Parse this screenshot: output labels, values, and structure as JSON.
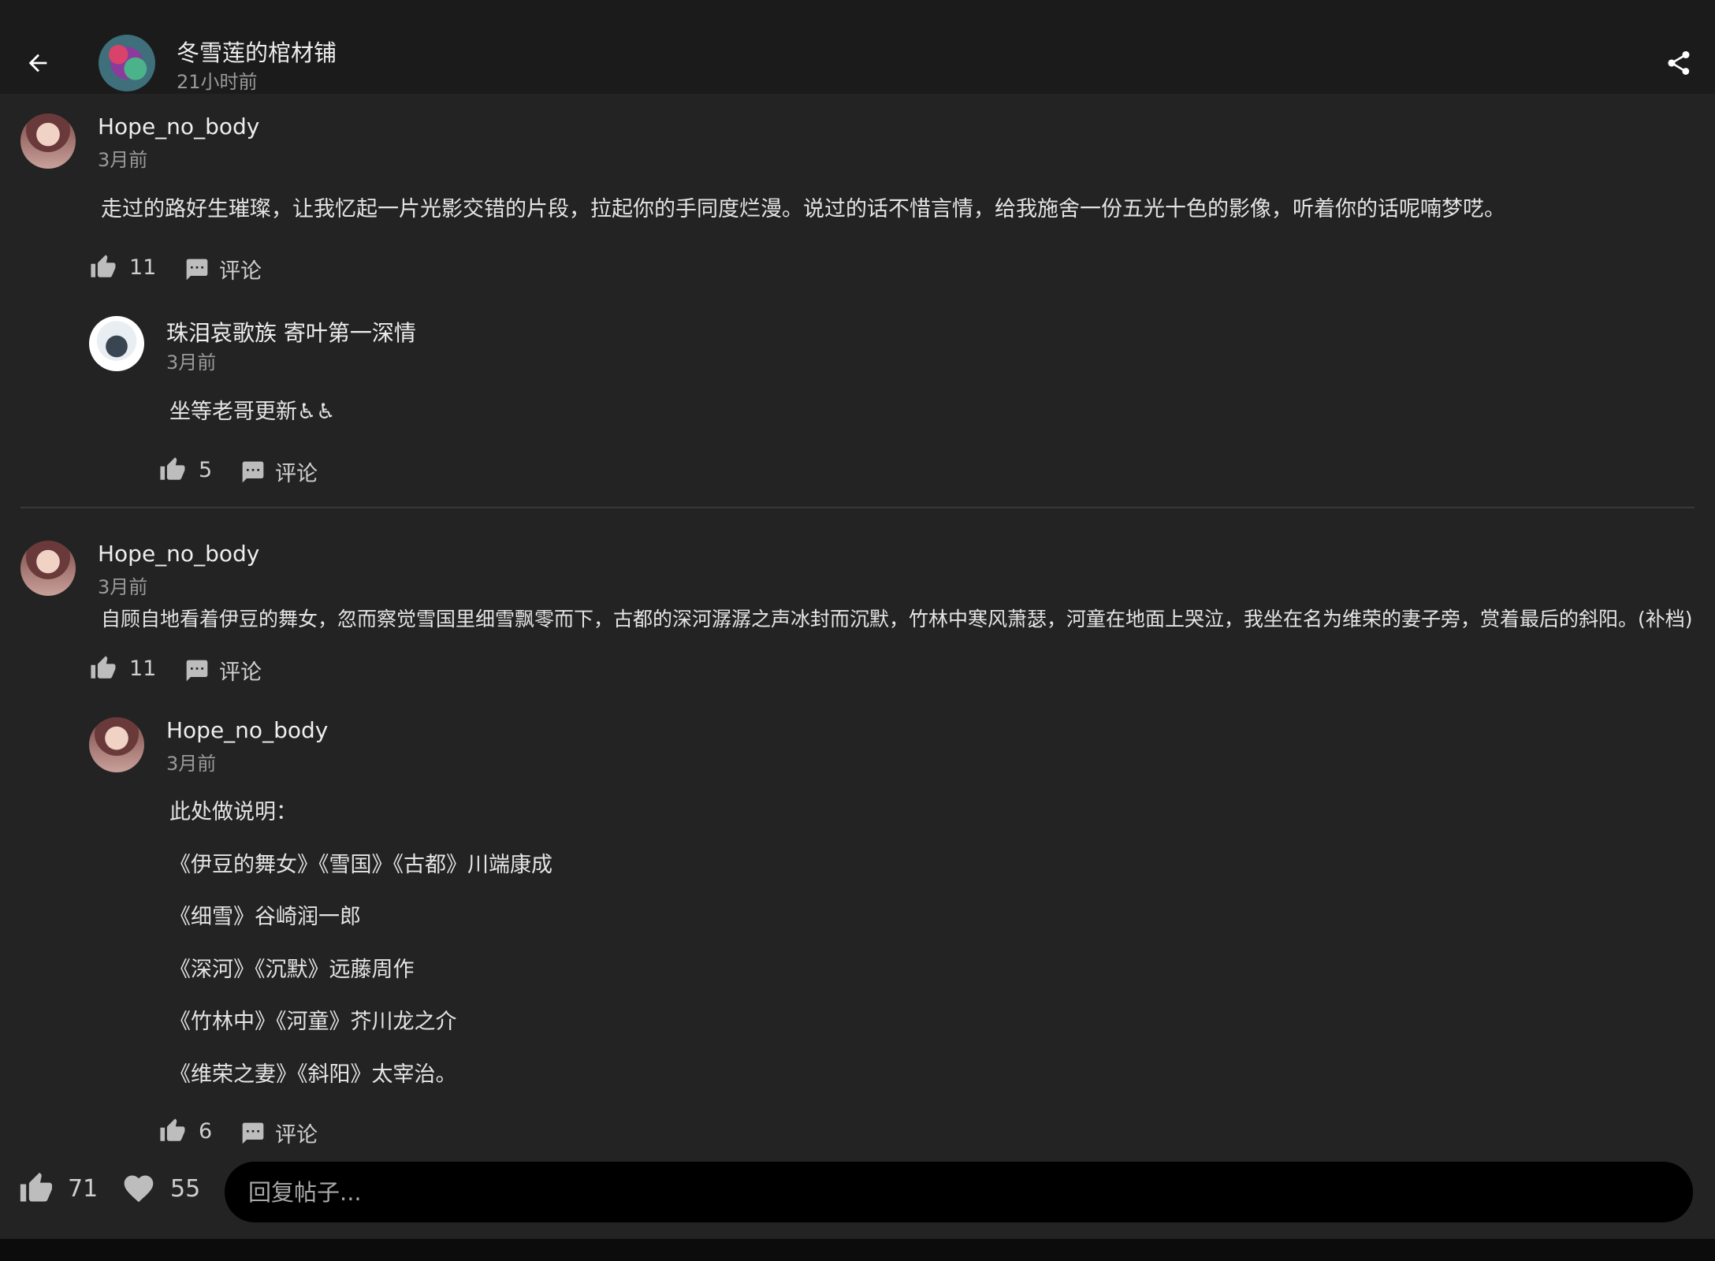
{
  "header": {
    "title": "冬雪莲的棺材铺",
    "time": "21小时前"
  },
  "comments": [
    {
      "user": "Hope_no_body",
      "time": "3月前",
      "text": "走过的路好生璀璨，让我忆起一片光影交错的片段，拉起你的手同度烂漫。说过的话不惜言情，给我施舍一份五光十色的影像，听着你的话呢喃梦呓。",
      "likes": "11",
      "comment_label": "评论",
      "reply": {
        "user": "珠泪哀歌族 寄叶第一深情",
        "time": "3月前",
        "text": "坐等老哥更新♿♿",
        "likes": "5",
        "comment_label": "评论"
      }
    },
    {
      "user": "Hope_no_body",
      "time": "3月前",
      "text": "自顾自地看着伊豆的舞女，忽而察觉雪国里细雪飘零而下，古都的深河潺潺之声冰封而沉默，竹林中寒风萧瑟，河童在地面上哭泣，我坐在名为维荣的妻子旁，赏着最后的斜阳。(补档)",
      "likes": "11",
      "comment_label": "评论",
      "reply": {
        "user": "Hope_no_body",
        "time": "3月前",
        "lines": [
          "此处做说明：",
          "《伊豆的舞女》《雪国》《古都》川端康成",
          "《细雪》谷崎润一郎",
          "《深河》《沉默》远藤周作",
          "《竹林中》《河童》芥川龙之介",
          "《维荣之妻》《斜阳》太宰治。"
        ],
        "likes": "6",
        "comment_label": "评论"
      }
    }
  ],
  "bottom": {
    "likes": "71",
    "favorites": "55",
    "reply_placeholder": "回复帖子..."
  },
  "icons": {
    "back": "arrow-left-icon",
    "share": "share-icon",
    "like": "thumb-up-icon",
    "comment": "comment-bubble-icon",
    "favorite": "heart-icon"
  }
}
